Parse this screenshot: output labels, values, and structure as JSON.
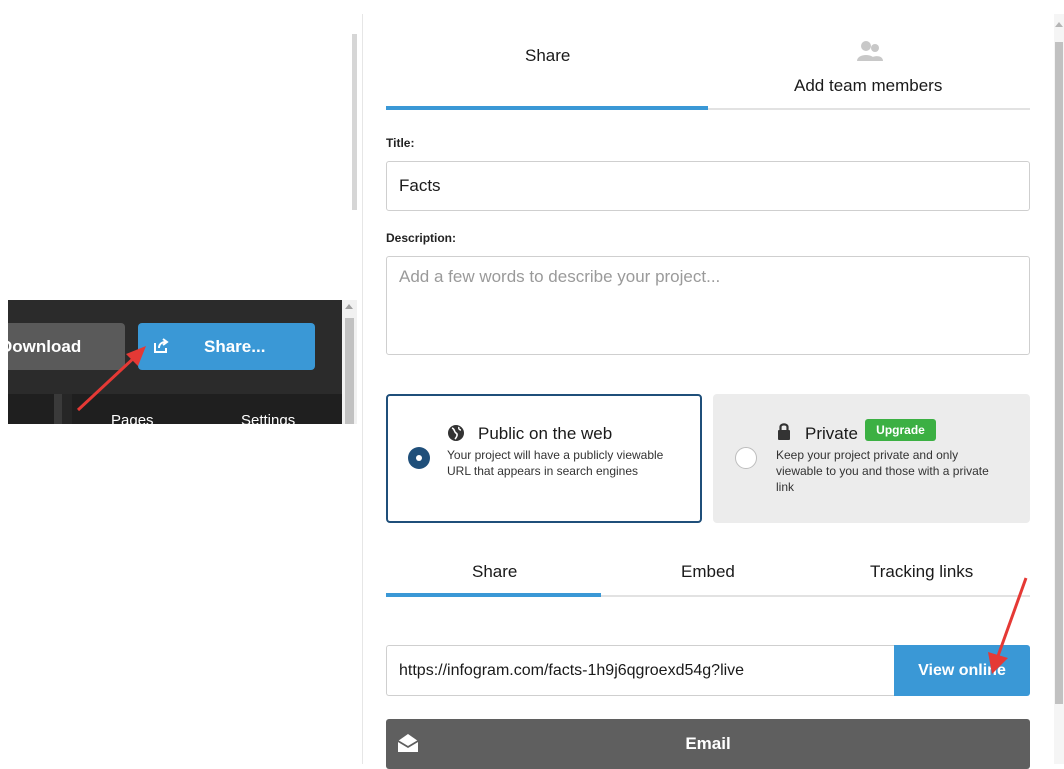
{
  "editor_toolbar": {
    "download_label": "Download",
    "share_label": "Share...",
    "tabs": [
      {
        "label": "Pages"
      },
      {
        "label": "Settings"
      }
    ]
  },
  "share_dialog": {
    "top_tabs": [
      {
        "label": "Share",
        "active": true
      },
      {
        "label": "Add team members",
        "active": false,
        "icon": "team-members-icon"
      }
    ],
    "title_field": {
      "label": "Title:",
      "value": "Facts"
    },
    "description_field": {
      "label": "Description:",
      "placeholder": "Add a few words to describe your project..."
    },
    "visibility": {
      "selected": "public",
      "public": {
        "title": "Public on the web",
        "description_line1": "Your project will have a publicly viewable",
        "description_line2": "URL that appears in search engines",
        "icon": "globe-icon"
      },
      "private": {
        "title": "Private",
        "badge": "Upgrade",
        "description_line1": "Keep your project private and only",
        "description_line2": "viewable to you and those with a private",
        "description_line3": "link",
        "icon": "lock-icon"
      }
    },
    "share_tabs": [
      {
        "label": "Share",
        "active": true
      },
      {
        "label": "Embed",
        "active": false
      },
      {
        "label": "Tracking links",
        "active": false
      }
    ],
    "share_url": "https://infogram.com/facts-1h9j6qgroexd54g?live",
    "view_online_label": "View online",
    "email_label": "Email"
  },
  "colors": {
    "accent": "#3a98d6",
    "selected_border": "#1f4f7a",
    "upgrade_badge": "#3cb043",
    "annotation_arrow": "#e53935"
  }
}
